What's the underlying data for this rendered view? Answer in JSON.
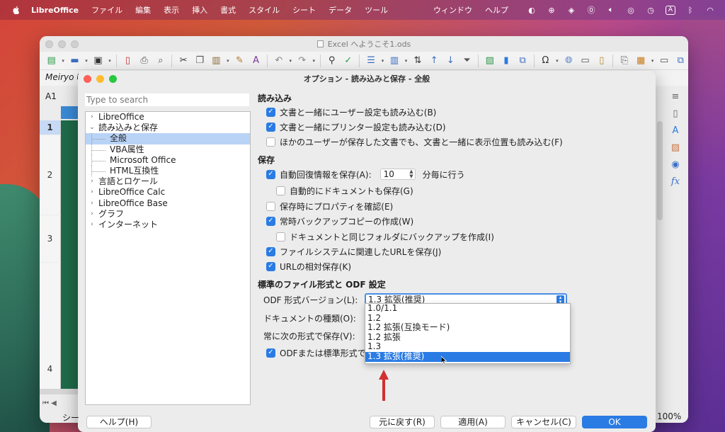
{
  "menubar": {
    "app": "LibreOffice",
    "items": [
      "ファイル",
      "編集",
      "表示",
      "挿入",
      "書式",
      "スタイル",
      "シート",
      "データ",
      "ツール"
    ],
    "right_items": [
      "ウィンドウ",
      "ヘルプ"
    ],
    "input_indicator": "A"
  },
  "window": {
    "title": "Excel へようこそ1.ods",
    "font_name": "Meiryo U",
    "cell_ref": "A1",
    "rows": [
      "1",
      "2",
      "3",
      "4"
    ],
    "sheet_tab": "シー",
    "zoom": "100%"
  },
  "dialog": {
    "title": "オプション - 読み込みと保存 - 全般",
    "search_placeholder": "Type to search",
    "tree": [
      {
        "label": "LibreOffice",
        "arrow": "›"
      },
      {
        "label": "読み込みと保存",
        "arrow": "⌄"
      },
      {
        "label": "全般",
        "child": true,
        "selected": true
      },
      {
        "label": "VBA属性",
        "child": true
      },
      {
        "label": "Microsoft Office",
        "child": true
      },
      {
        "label": "HTML互換性",
        "child": true
      },
      {
        "label": "言語とロケール",
        "arrow": "›"
      },
      {
        "label": "LibreOffice Calc",
        "arrow": "›"
      },
      {
        "label": "LibreOffice Base",
        "arrow": "›"
      },
      {
        "label": "グラフ",
        "arrow": "›"
      },
      {
        "label": "インターネット",
        "arrow": "›"
      }
    ],
    "load": {
      "header": "読み込み",
      "opt1": "文書と一緒にユーザー設定も読み込む(B)",
      "opt2": "文書と一緒にプリンター設定も読み込む(D)",
      "opt3": "ほかのユーザーが保存した文書でも、文書と一緒に表示位置も読み込む(F)"
    },
    "save": {
      "header": "保存",
      "autorecover": "自動回復情報を保存(A):",
      "autorecover_value": "10",
      "autorecover_unit": "分毎に行う",
      "autosave_doc": "自動的にドキュメントも保存(G)",
      "confirm_props": "保存時にプロパティを確認(E)",
      "backup": "常時バックアップコピーの作成(W)",
      "backup_same_folder": "ドキュメントと同じフォルダにバックアップを作成(I)",
      "url_fs": "ファイルシステムに関連したURLを保存(J)",
      "url_relative": "URLの相対保存(K)"
    },
    "odf": {
      "header": "標準のファイル形式と ODF 設定",
      "version_label": "ODF 形式バージョン(L):",
      "version_value": "1.3 拡張(推奨)",
      "doc_type_label": "ドキュメントの種類(O):",
      "always_save_label": "常に次の形式で保存(V):",
      "warn_label": "ODFまたは標準形式で",
      "options": [
        "1.0/1.1",
        "1.2",
        "1.2 拡張(互換モード)",
        "1.2 拡張",
        "1.3",
        "1.3 拡張(推奨)"
      ],
      "selected_index": 5
    },
    "buttons": {
      "help": "ヘルプ(H)",
      "reset": "元に戻す(R)",
      "apply": "適用(A)",
      "cancel": "キャンセル(C)",
      "ok": "OK"
    }
  },
  "colors": {
    "accent": "#2a7be4",
    "annotation_arrow": "#d32f2f"
  }
}
